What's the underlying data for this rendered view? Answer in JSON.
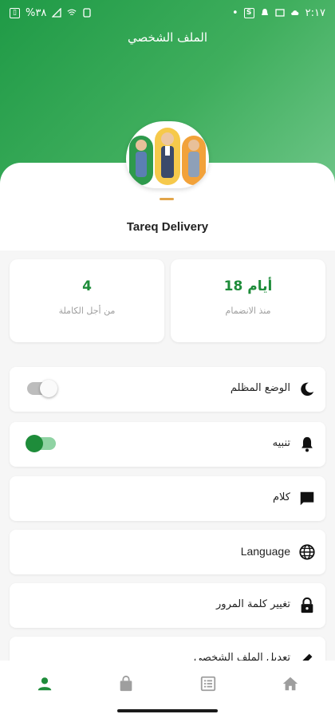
{
  "status_bar": {
    "left_text": "%٣٨",
    "time": "٢:١٧"
  },
  "header": {
    "title": "الملف الشخصي"
  },
  "profile": {
    "name": "Tareq Delivery"
  },
  "stats": [
    {
      "value": "4",
      "label": "من أجل الكاملة"
    },
    {
      "value": "18 أيام",
      "label": "منذ الانضمام"
    }
  ],
  "settings": {
    "dark_mode": {
      "label": "الوضع المظلم",
      "enabled": false
    },
    "alert": {
      "label": "تنبيه",
      "enabled": true
    },
    "chat": {
      "label": "كلام"
    },
    "language": {
      "label": "Language"
    },
    "change_password": {
      "label": "تغيير كلمة المرور"
    },
    "edit_profile": {
      "label": "تعديل الملف الشخصي"
    }
  },
  "bottom_nav": {
    "items": [
      "profile-icon",
      "bag-icon",
      "list-icon",
      "home-icon"
    ],
    "active": "profile-icon"
  },
  "colors": {
    "primary": "#1e8c3a",
    "header_gradient_start": "#1f9a46",
    "header_gradient_end": "#6dc587",
    "inactive_icon": "#9e9e9e",
    "dash_accent": "#e2a54a"
  }
}
